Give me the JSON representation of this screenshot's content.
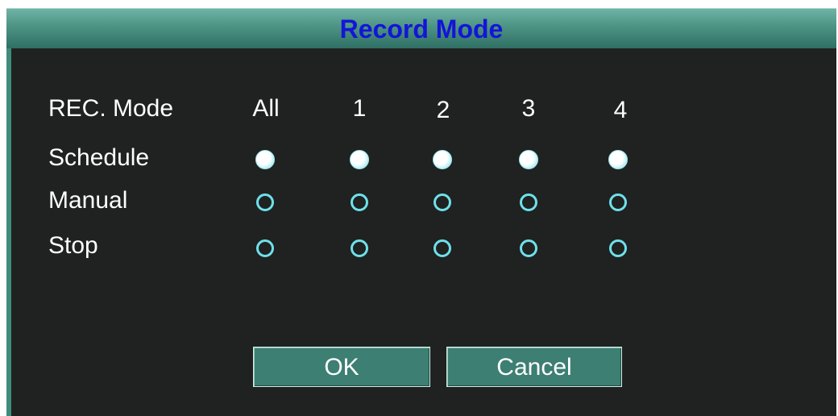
{
  "dialog": {
    "title": "Record Mode"
  },
  "table": {
    "row_header_label": "REC. Mode",
    "columns": [
      "All",
      "1",
      "2",
      "3",
      "4"
    ],
    "rows": [
      {
        "label": "Schedule",
        "selected": [
          true,
          true,
          true,
          true,
          true
        ]
      },
      {
        "label": "Manual",
        "selected": [
          false,
          false,
          false,
          false,
          false
        ]
      },
      {
        "label": "Stop",
        "selected": [
          false,
          false,
          false,
          false,
          false
        ]
      }
    ]
  },
  "buttons": {
    "ok_label": "OK",
    "cancel_label": "Cancel"
  },
  "colors": {
    "title_text": "#1414d8",
    "title_bar": "#4f9687",
    "panel_bg": "#1f2220",
    "radio_accent": "#6fe0ea",
    "button_bg": "#3d7f72"
  }
}
